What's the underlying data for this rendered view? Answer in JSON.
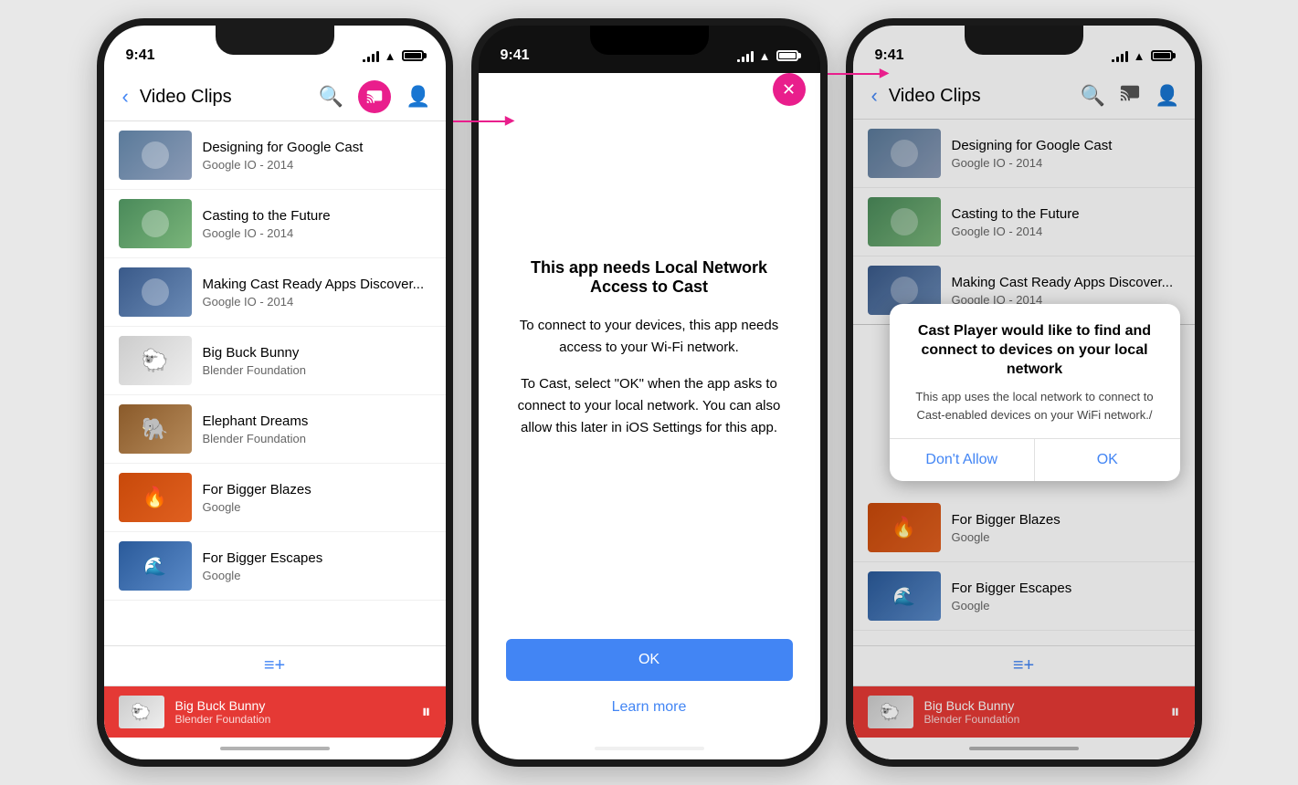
{
  "phones": {
    "left": {
      "statusBar": {
        "time": "9:41",
        "signalBars": [
          3,
          6,
          9,
          12,
          14
        ],
        "batteryFull": true
      },
      "header": {
        "backLabel": "‹",
        "title": "Video Clips",
        "searchLabel": "🔍",
        "castActive": true,
        "profileLabel": "👤"
      },
      "videos": [
        {
          "id": "designing",
          "title": "Designing for Google Cast",
          "subtitle": "Google IO - 2014",
          "thumbClass": "thumb-designing"
        },
        {
          "id": "casting",
          "title": "Casting to the Future",
          "subtitle": "Google IO - 2014",
          "thumbClass": "thumb-casting"
        },
        {
          "id": "making",
          "title": "Making Cast Ready Apps Discover...",
          "subtitle": "Google IO - 2014",
          "thumbClass": "thumb-making"
        },
        {
          "id": "bbb",
          "title": "Big Buck Bunny",
          "subtitle": "Blender Foundation",
          "thumbClass": "thumb-bbb"
        },
        {
          "id": "elephant",
          "title": "Elephant Dreams",
          "subtitle": "Blender Foundation",
          "thumbClass": "thumb-elephant"
        },
        {
          "id": "blazes",
          "title": "For Bigger Blazes",
          "subtitle": "Google",
          "thumbClass": "thumb-blazes"
        },
        {
          "id": "escapes",
          "title": "For Bigger Escapes",
          "subtitle": "Google",
          "thumbClass": "thumb-escapes"
        }
      ],
      "queueButtonLabel": "≡+",
      "nowPlaying": {
        "title": "Big Buck Bunny",
        "subtitle": "Blender Foundation",
        "thumbClass": "thumb-bbb"
      }
    },
    "middle": {
      "statusBar": {
        "time": "9:41"
      },
      "closeButton": "✕",
      "dialog": {
        "title": "This app needs Local Network Access to Cast",
        "body1": "To connect to your devices, this app needs access to your Wi-Fi network.",
        "body2": "To Cast, select \"OK\" when the app asks to connect to your local network. You can also allow this later in iOS Settings for this app.",
        "okLabel": "OK",
        "learnMoreLabel": "Learn more"
      }
    },
    "right": {
      "statusBar": {
        "time": "9:41"
      },
      "header": {
        "backLabel": "‹",
        "title": "Video Clips",
        "searchLabel": "🔍",
        "castNormal": true,
        "profileLabel": "👤"
      },
      "videos": [
        {
          "id": "designing",
          "title": "Designing for Google Cast",
          "subtitle": "Google IO - 2014",
          "thumbClass": "thumb-designing"
        },
        {
          "id": "casting",
          "title": "Casting to the Future",
          "subtitle": "Google IO - 2014",
          "thumbClass": "thumb-casting"
        },
        {
          "id": "making",
          "title": "Making Cast Ready Apps Discover...",
          "subtitle": "Google IO - 2014",
          "thumbClass": "thumb-making"
        }
      ],
      "overlayDialog": {
        "title": "Cast Player would like to find and connect to devices on your local network",
        "body": "This app uses the local network to connect to Cast-enabled devices on your WiFi network./",
        "dontAllowLabel": "Don't Allow",
        "okLabel": "OK"
      },
      "videosBelow": [
        {
          "id": "blazes",
          "title": "For Bigger Blazes",
          "subtitle": "Google",
          "thumbClass": "thumb-blazes"
        },
        {
          "id": "escapes",
          "title": "For Bigger Escapes",
          "subtitle": "Google",
          "thumbClass": "thumb-escapes"
        }
      ],
      "queueButtonLabel": "≡+",
      "nowPlaying": {
        "title": "Big Buck Bunny",
        "subtitle": "Blender Foundation",
        "thumbClass": "thumb-bbb"
      }
    }
  }
}
